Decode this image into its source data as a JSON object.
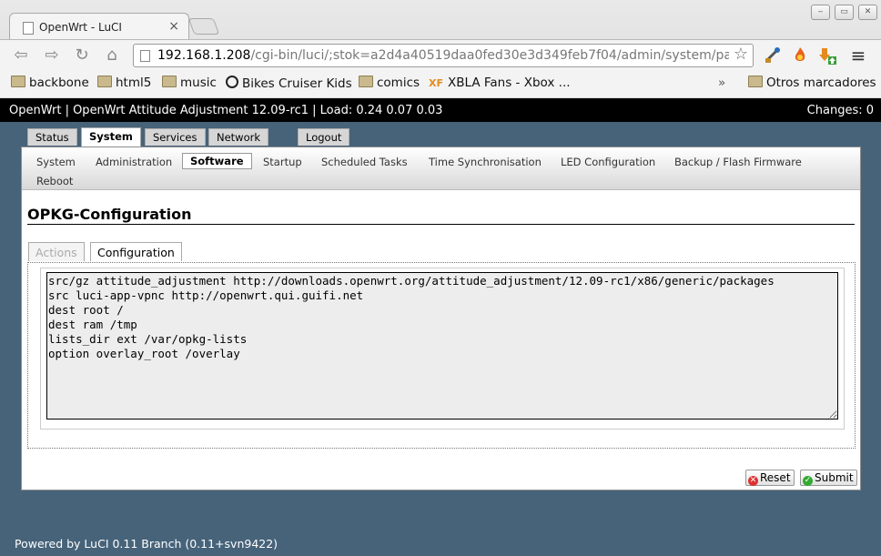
{
  "browser": {
    "tab_title": "OpenWrt - LuCI",
    "tab_close": "×",
    "url_host": "192.168.1.208",
    "url_path": "/cgi-bin/luci/;stok=a2d4a40519daa0fed30e3d349feb7f04/admin/system/packages",
    "window_buttons": [
      "‒",
      "▭",
      "✕"
    ],
    "nav_glyphs": {
      "back": "⇦",
      "forward": "⇨",
      "reload": "↻",
      "home": "⌂",
      "star": "☆",
      "menu": "≡"
    },
    "bookmarks": [
      "backbone",
      "html5",
      "music",
      "Bikes Cruiser Kids",
      "comics",
      "XBLA Fans - Xbox ..."
    ],
    "bookmarks_overflow": "»",
    "other_bookmarks": "Otros marcadores",
    "xf_badge": "XF"
  },
  "header": {
    "left_text": "OpenWrt | OpenWrt Attitude Adjustment 12.09-rc1 | Load: 0.24 0.07 0.03",
    "changes_text": "Changes: 0"
  },
  "menu_tabs": [
    "Status",
    "System",
    "Services",
    "Network",
    "Logout"
  ],
  "submenu": [
    "System",
    "Administration",
    "Software",
    "Startup",
    "Scheduled Tasks",
    "Time Synchronisation",
    "LED Configuration",
    "Backup / Flash Firmware",
    "Reboot"
  ],
  "page_title": "OPKG-Configuration",
  "content_tabs": [
    "Actions",
    "Configuration"
  ],
  "config_text": "src/gz attitude_adjustment http://downloads.openwrt.org/attitude_adjustment/12.09-rc1/x86/generic/packages\nsrc luci-app-vpnc http://openwrt.qui.guifi.net\ndest root /\ndest ram /tmp\nlists_dir ext /var/opkg-lists\noption overlay_root /overlay",
  "buttons": {
    "reset": "Reset",
    "submit": "Submit",
    "reset_icon": "✕",
    "submit_icon": "✓"
  },
  "footer": "Powered by LuCI 0.11 Branch (0.11+svn9422)",
  "colors": {
    "page_bg": "#46637a",
    "header_bg": "#000000",
    "text_area_bg": "#ededed"
  }
}
